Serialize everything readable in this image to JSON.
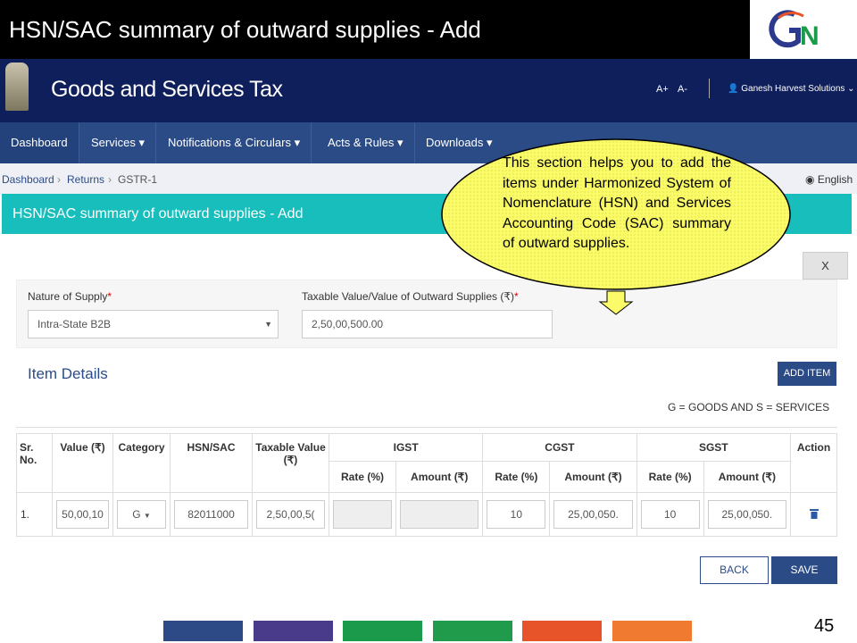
{
  "slide": {
    "title": "HSN/SAC summary of outward supplies - Add",
    "page_number": "45",
    "logo": "GSTN",
    "bar_colors": [
      "#2d4a86",
      "#4a3a8a",
      "#1a9a4a",
      "#1f9b4b",
      "#e8542a",
      "#f07a30"
    ]
  },
  "header": {
    "title": "Goods and Services Tax",
    "font_increase": "A+",
    "font_decrease": "A-",
    "user": "Ganesh Harvest Solutions"
  },
  "nav": [
    "Dashboard",
    "Services",
    "Notifications & Circulars",
    "Acts & Rules",
    "Downloads"
  ],
  "breadcrumb": [
    "Dashboard",
    "Returns",
    "GSTR-1"
  ],
  "language": "English",
  "panel": {
    "title": "HSN/SAC summary of outward supplies - Add",
    "close": "X"
  },
  "form": {
    "nature_label": "Nature of Supply",
    "nature_value": "Intra-State B2B",
    "taxable_label": "Taxable Value/Value of Outward Supplies (₹)",
    "taxable_value": "2,50,00,500.00",
    "required": "*"
  },
  "items": {
    "title": "Item Details",
    "add_button": "ADD ITEM",
    "note": "G = GOODS AND S = SERVICES"
  },
  "table": {
    "headers": {
      "sr": "Sr. No.",
      "value": "Value (₹)",
      "category": "Category",
      "hsn": "HSN/SAC",
      "taxable": "Taxable Value (₹)",
      "igst": "IGST",
      "cgst": "CGST",
      "sgst": "SGST",
      "action": "Action",
      "rate": "Rate (%)",
      "amount": "Amount (₹)"
    },
    "rows": [
      {
        "sr": "1.",
        "value": "50,00,10",
        "category": "G",
        "hsn": "82011000",
        "taxable": "2,50,00,5(",
        "igst_rate": "",
        "igst_amount": "",
        "cgst_rate": "10",
        "cgst_amount": "25,00,050.",
        "sgst_rate": "10",
        "sgst_amount": "25,00,050."
      }
    ]
  },
  "buttons": {
    "back": "BACK",
    "save": "SAVE"
  },
  "callout": {
    "text": "This section helps you to add the items under Harmonized System of Nomenclature (HSN) and Services Accounting Code (SAC) summary of outward supplies."
  }
}
